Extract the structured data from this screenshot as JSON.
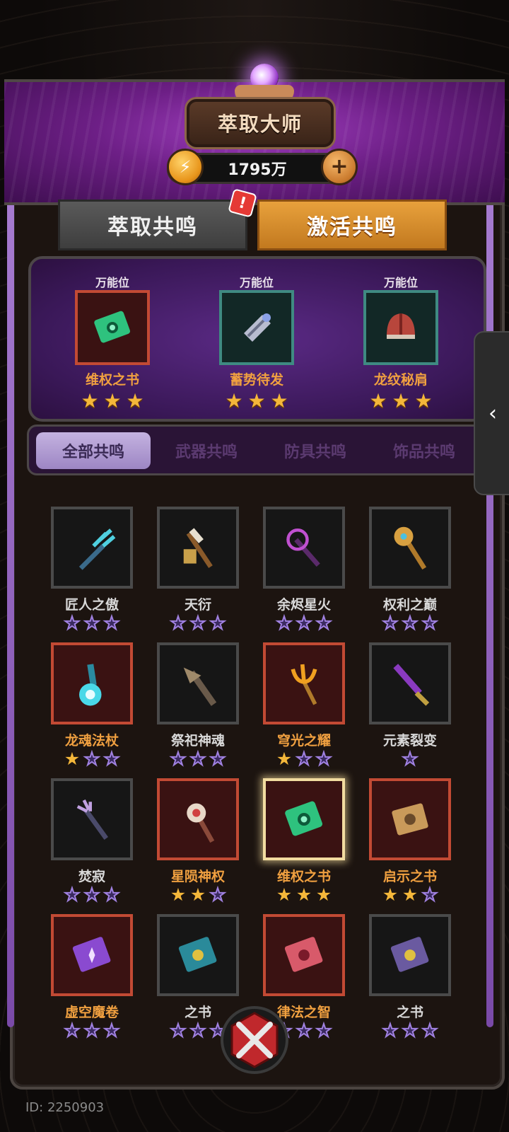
{
  "header": {
    "title": "萃取大师",
    "coins": "1795万",
    "coin_icon": "lightning-coin-icon",
    "plus_icon": "plus-icon"
  },
  "tabs": [
    {
      "label": "萃取共鸣",
      "active": false,
      "badge": "!"
    },
    {
      "label": "激活共鸣",
      "active": true
    }
  ],
  "slots": [
    {
      "label": "万能位",
      "name": "维权之书",
      "stars": 3,
      "rarity": "red",
      "icon": "green-book-icon"
    },
    {
      "label": "万能位",
      "name": "蓄势待发",
      "stars": 3,
      "rarity": "teal",
      "icon": "gauntlet-icon"
    },
    {
      "label": "万能位",
      "name": "龙纹秘肩",
      "stars": 3,
      "rarity": "teal",
      "icon": "helmet-icon"
    }
  ],
  "filters": [
    "全部共鸣",
    "武器共鸣",
    "防具共鸣",
    "饰品共鸣"
  ],
  "active_filter": 0,
  "items": [
    {
      "name": "匠人之傲",
      "rarity": "gray",
      "stars": 0,
      "icon": "trident-icon"
    },
    {
      "name": "天衍",
      "rarity": "gray",
      "stars": 0,
      "icon": "spear-icon"
    },
    {
      "name": "余烬星火",
      "rarity": "gray",
      "stars": 0,
      "icon": "dark-staff-icon"
    },
    {
      "name": "权利之巅",
      "rarity": "gray",
      "stars": 0,
      "icon": "scepter-icon"
    },
    {
      "name": "龙魂法杖",
      "rarity": "red",
      "stars": 1,
      "icon": "orb-staff-icon"
    },
    {
      "name": "祭祀神魂",
      "rarity": "gray",
      "stars": 0,
      "icon": "bird-staff-icon"
    },
    {
      "name": "穹光之耀",
      "rarity": "red",
      "stars": 1,
      "icon": "fire-trident-icon"
    },
    {
      "name": "元素裂变",
      "rarity": "gray",
      "stars": 0,
      "star_total": 1,
      "icon": "dagger-icon"
    },
    {
      "name": "焚寂",
      "rarity": "gray",
      "stars": 0,
      "icon": "purple-trident-icon"
    },
    {
      "name": "星陨神权",
      "rarity": "red",
      "stars": 2,
      "icon": "star-scepter-icon"
    },
    {
      "name": "维权之书",
      "rarity": "red",
      "stars": 3,
      "selected": true,
      "icon": "green-book-icon"
    },
    {
      "name": "启示之书",
      "rarity": "red",
      "stars": 2,
      "icon": "scroll-book-icon"
    },
    {
      "name": "虚空魔卷",
      "rarity": "red",
      "stars": 0,
      "icon": "purple-book-icon"
    },
    {
      "name": "之书",
      "rarity": "gray",
      "stars": 0,
      "icon": "blue-book-icon"
    },
    {
      "name": "律法之智",
      "rarity": "red",
      "stars": 0,
      "icon": "pink-book-icon"
    },
    {
      "name": "之书",
      "rarity": "gray",
      "stars": 0,
      "icon": "violet-book-icon"
    }
  ],
  "colors": {
    "red_name": "#f0a040",
    "gray_name": "#d8d8d8",
    "accent_orange": "#e8a13c",
    "purple": "#6d1f86"
  },
  "side_tab": {
    "icon": "chevron-left-icon",
    "label": "‹"
  },
  "footer": {
    "id_text": "ID: 2250903"
  }
}
